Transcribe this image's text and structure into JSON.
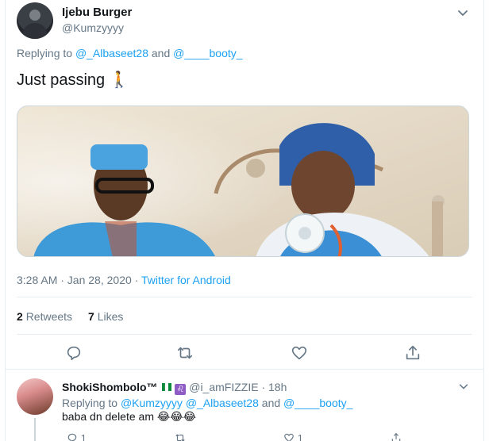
{
  "tweet": {
    "display_name": "Ijebu Burger",
    "handle": "@Kumzyyyy",
    "replying_prefix": "Replying to",
    "replying_mention_1": "@_Albaseet28",
    "replying_and": "and",
    "replying_mention_2": "@____booty_",
    "text": "Just passing 🚶",
    "time": "3:28 AM · Jan 28, 2020 · ",
    "source": "Twitter for Android",
    "retweets_count": "2",
    "retweets_label": "Retweets",
    "likes_count": "7",
    "likes_label": "Likes"
  },
  "reply": {
    "display_name": "ShokiShombolo™",
    "handle_meta": "@i_amFIZZIE · 18h",
    "replying_prefix": "Replying to",
    "replying_mentions": "@Kumzyyyy @_Albaseet28",
    "replying_and": "and",
    "replying_mention_last": "@____booty_",
    "text": "baba dn delete am 😂😂😂",
    "reply_count": "1",
    "like_count": "1"
  },
  "icons": {
    "chevron": "chevron-down-icon",
    "reply": "reply-icon",
    "retweet": "retweet-icon",
    "like": "heart-icon",
    "share": "share-icon"
  },
  "colors": {
    "accent": "#1da1f2",
    "secondary_text": "#657786",
    "border": "#e6ecf0"
  }
}
